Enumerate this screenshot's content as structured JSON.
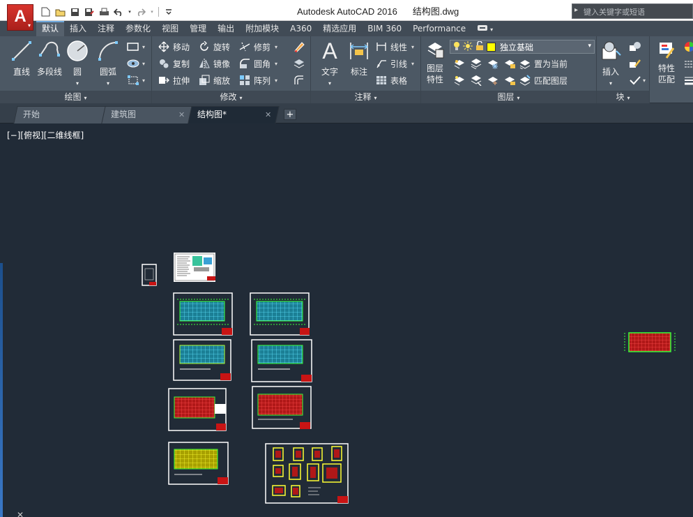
{
  "app": {
    "title": "Autodesk AutoCAD 2016",
    "filename": "结构图.dwg",
    "search_placeholder": "键入关键字或短语"
  },
  "ribbon_tabs": [
    {
      "label": "默认",
      "active": true
    },
    {
      "label": "插入"
    },
    {
      "label": "注释"
    },
    {
      "label": "参数化"
    },
    {
      "label": "视图"
    },
    {
      "label": "管理"
    },
    {
      "label": "输出"
    },
    {
      "label": "附加模块"
    },
    {
      "label": "A360"
    },
    {
      "label": "精选应用"
    },
    {
      "label": "BIM 360"
    },
    {
      "label": "Performance"
    }
  ],
  "panels": {
    "draw": {
      "title": "绘图",
      "line": "直线",
      "polyline": "多段线",
      "circle": "圆",
      "arc": "圆弧"
    },
    "modify": {
      "title": "修改",
      "move": "移动",
      "rotate": "旋转",
      "trim": "修剪",
      "copy": "复制",
      "mirror": "镜像",
      "fillet": "圆角",
      "stretch": "拉伸",
      "scale": "缩放",
      "array": "阵列"
    },
    "annotation": {
      "title": "注释",
      "text": "文字",
      "dimension": "标注",
      "linear": "线性",
      "leader": "引线",
      "table": "表格"
    },
    "layers": {
      "title": "图层",
      "layer_properties_1": "图层",
      "layer_properties_2": "特性",
      "current_layer": "独立基础",
      "current_layer_color": "#ffff00",
      "make_current": "置为当前",
      "match_layer": "匹配图层"
    },
    "block": {
      "title": "块",
      "insert": "插入"
    },
    "properties": {
      "match_1": "特性",
      "match_2": "匹配"
    }
  },
  "file_tabs": [
    {
      "label": "开始"
    },
    {
      "label": "建筑图"
    },
    {
      "label": "结构图*",
      "active": true
    }
  ],
  "viewport": {
    "label": "[−][俯视][二维线框]"
  },
  "colors": {
    "canvas": "#212b37",
    "ribbon": "#4c5864",
    "accent": "#d8342d"
  }
}
